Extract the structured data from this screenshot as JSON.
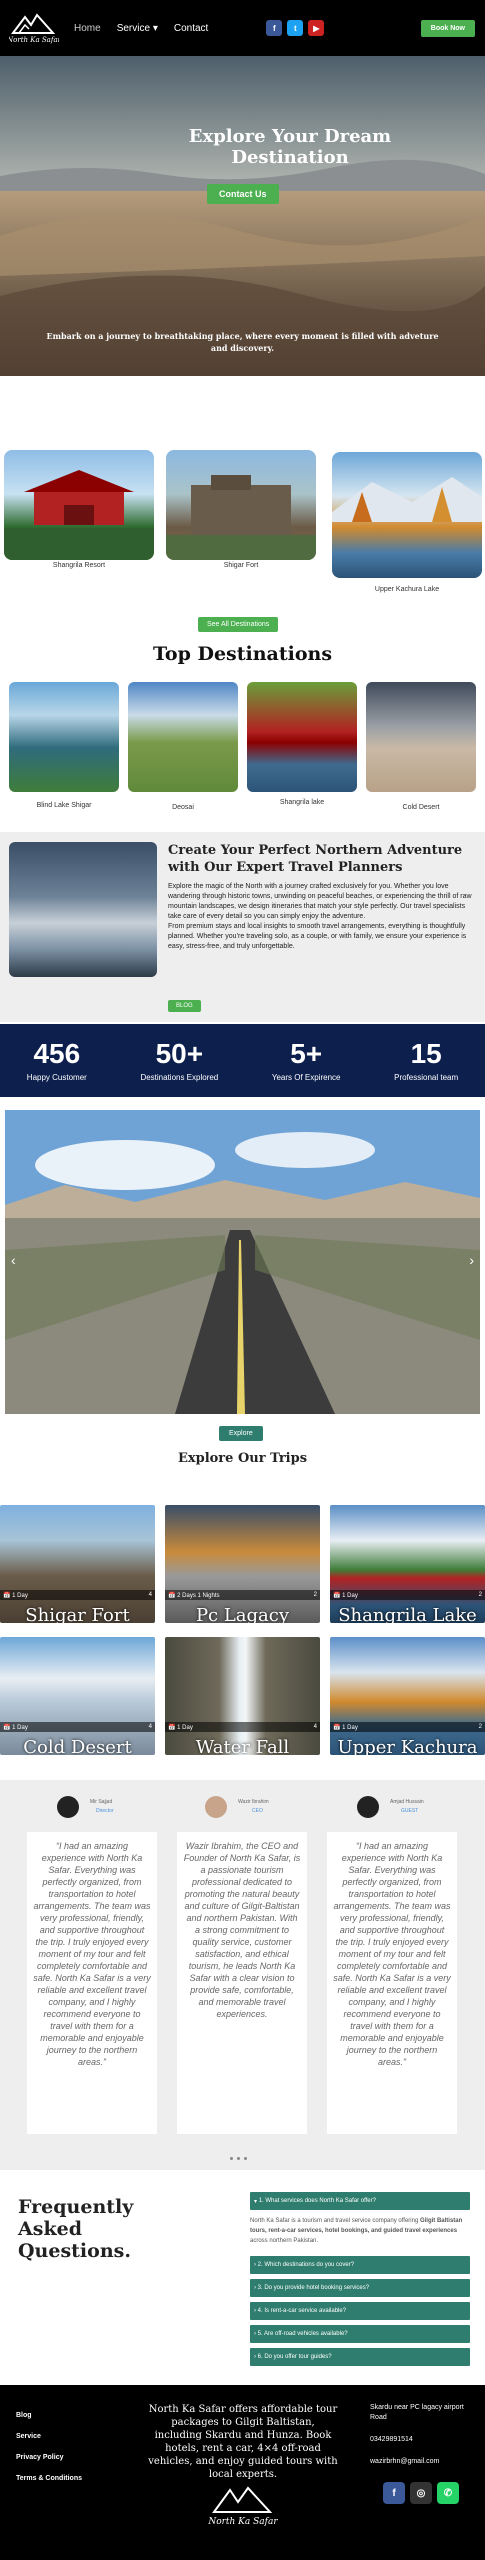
{
  "header": {
    "logo_text": "North Ka Safar",
    "nav": {
      "home": "Home",
      "service": "Service",
      "contact": "Contact"
    },
    "book_now": "Book Now",
    "social_icons": [
      "facebook-icon",
      "twitter-icon",
      "youtube-icon"
    ]
  },
  "hero": {
    "title": "Explore Your Dream Destination",
    "button": "Contact Us",
    "subtitle": "Embark on a journey to breathtaking place, where every moment is filled with adveture and discovery."
  },
  "featured": [
    {
      "caption": "Shangrila Resort"
    },
    {
      "caption": "Shigar Fort"
    },
    {
      "caption": "Upper Kachura Lake"
    }
  ],
  "see_all_button": "See All Destinations",
  "top_destinations": {
    "title": "Top Destinations",
    "items": [
      {
        "caption": "Blind Lake Shigar"
      },
      {
        "caption": "Deosai"
      },
      {
        "caption": "Shangrila lake"
      },
      {
        "caption": "Cold Desert"
      }
    ]
  },
  "about": {
    "title": "Create Your Perfect Northern Adventure with Our Expert Travel Planners",
    "para1": "Explore the magic of the North with a journey crafted exclusively for you. Whether you love wandering through historic towns, unwinding on peaceful beaches, or experiencing the thrill of raw mountain landscapes, we design itineraries that match your style perfectly. Our travel specialists take care of every detail so you can simply enjoy the adventure.",
    "para2": "From premium stays and local insights to smooth travel arrangements, everything is thoughtfully planned. Whether you’re traveling solo, as a couple, or with family, we ensure your experience is easy, stress-free, and truly unforgettable.",
    "button": "BLOG"
  },
  "stats": [
    {
      "number": "456",
      "label": "Happy Customer"
    },
    {
      "number": "50+",
      "label": "Destinations Explored"
    },
    {
      "number": "5+",
      "label": "Years Of Expirence"
    },
    {
      "number": "15",
      "label": "Professional team"
    }
  ],
  "slider": {
    "prev": "‹",
    "next": "›"
  },
  "explore_button": "Explore",
  "trips": {
    "title": "Explore Our Trips",
    "items": [
      {
        "duration": "1 Day",
        "count": "4",
        "title": "Shigar Fort"
      },
      {
        "duration": "2 Days 1 Nights",
        "count": "2",
        "title": "Pc Lagacy"
      },
      {
        "duration": "1 Day",
        "count": "2",
        "title": "Shangrila Lake"
      },
      {
        "duration": "1 Day",
        "count": "4",
        "title": "Cold Desert"
      },
      {
        "duration": "1 Day",
        "count": "4",
        "title": "Water Fall"
      },
      {
        "duration": "1 Day",
        "count": "2",
        "title": "Upper Kachura"
      }
    ]
  },
  "testimonials": [
    {
      "name": "Mir Sajjad",
      "role": "Director",
      "text": "“I had an amazing experience with North Ka Safar. Everything was perfectly organized, from transportation to hotel arrangements. The team was very professional, friendly, and supportive throughout the trip. I truly enjoyed every moment of my tour and felt completely comfortable and safe. North Ka Safar is a very reliable and excellent travel company, and I highly recommend everyone to travel with them for a memorable and enjoyable journey to the northern areas.”"
    },
    {
      "name": "Wazir Ibrahim",
      "role": "CEO",
      "text": "Wazir Ibrahim, the CEO and Founder of North Ka Safar, is a passionate tourism professional dedicated to promoting the natural beauty and culture of Gilgit-Baltistan and northern Pakistan. With a strong commitment to quality service, customer satisfaction, and ethical tourism, he leads North Ka Safar with a clear vision to provide safe, comfortable, and memorable travel experiences."
    },
    {
      "name": "Amjad Hussain",
      "role": "GUEST",
      "text": "“I had an amazing experience with North Ka Safar. Everything was perfectly organized, from transportation to hotel arrangements. The team was very professional, friendly, and supportive throughout the trip. I truly enjoyed every moment of my tour and felt completely comfortable and safe. North Ka Safar is a very reliable and excellent travel company, and I highly recommend everyone to travel with them for a memorable and enjoyable journey to the northern areas.”"
    }
  ],
  "faq": {
    "title": "Frequently Asked Questions.",
    "items": [
      {
        "q": "1. What services does North Ka Safar offer?"
      },
      {
        "q": "2. Which destinations do you cover?"
      },
      {
        "q": "3. Do you provide hotel booking services?"
      },
      {
        "q": "4. Is rent-a-car service available?"
      },
      {
        "q": "5. Are off-road vehicles available?"
      },
      {
        "q": "6. Do you offer tour guides?"
      }
    ],
    "answer_pre": "North Ka Safar is a tourism and travel service company offering ",
    "answer_bold": "Gilgit Baltistan tours, rent-a-car services, hotel bookings, and guided travel experiences",
    "answer_post": " across northern Pakistan."
  },
  "footer": {
    "links": [
      "Blog",
      "Service",
      "Privacy Policy",
      "Terms & Conditions"
    ],
    "about": "North Ka Safar offers affordable tour packages to Gilgit Baltistan, including Skardu and Hunza. Book hotels, rent a car, 4×4 off-road vehicles, and enjoy guided tours with local experts.",
    "address": "Skardu near PC lagacy airport Road",
    "phone": "03429891514",
    "email": "wazirbrhn@gmail.com",
    "social_icons": [
      "facebook-icon",
      "instagram-icon",
      "whatsapp-icon"
    ]
  },
  "colors": {
    "accent": "#4caf50",
    "teal": "#2f7d6e",
    "navy": "#0d1f4d"
  }
}
